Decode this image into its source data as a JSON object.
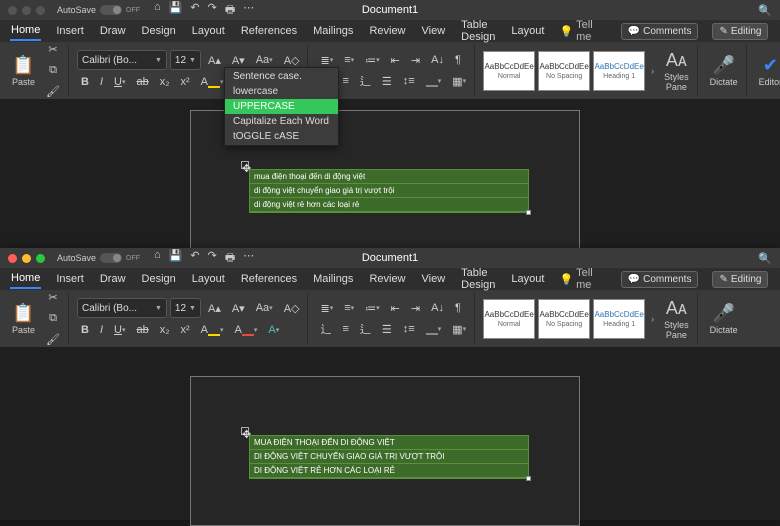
{
  "doc_title": "Document1",
  "autosave_label": "AutoSave",
  "autosave_state": "OFF",
  "tabs": [
    "Home",
    "Insert",
    "Draw",
    "Design",
    "Layout",
    "References",
    "Mailings",
    "Review",
    "View",
    "Table Design",
    "Layout"
  ],
  "tellme": "Tell me",
  "comments_btn": "Comments",
  "editing_btn": "Editing",
  "font": {
    "name": "Calibri (Bo...",
    "size": "12"
  },
  "paste_label": "Paste",
  "styles": [
    {
      "preview": "AaBbCcDdEe",
      "name": "Normal"
    },
    {
      "preview": "AaBbCcDdEe",
      "name": "No Spacing"
    },
    {
      "preview": "AaBbCcDdEe",
      "name": "Heading 1"
    }
  ],
  "styles_pane": "Styles\nPane",
  "dictate": "Dictate",
  "editor": "Editor",
  "case_menu": [
    "Sentence case.",
    "lowercase",
    "UPPERCASE",
    "Capitalize Each Word",
    "tOGGLE cASE"
  ],
  "case_menu_selected": 2,
  "table_rows_before": [
    "mua điện thoại đến di động việt",
    "di động việt chuyển giao giá trị vượt trội",
    "di động việt rẻ hơn các loại rẻ"
  ],
  "table_rows_after": [
    "MUA ĐIỆN THOẠI ĐẾN DI ĐỘNG VIỆT",
    "DI ĐỘNG VIỆT CHUYỂN GIAO GIÁ TRỊ VƯỢT TRỘI",
    "DI ĐỘNG VIỆT RẺ HƠN CÁC LOẠI RẺ"
  ]
}
